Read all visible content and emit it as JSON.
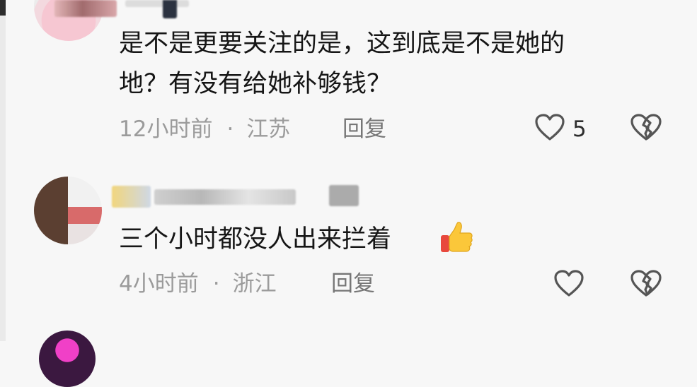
{
  "comments": [
    {
      "text_line1": "是不是更要关注的是，这到底是不是她的",
      "text_line2": "地？有没有给她补够钱？",
      "time": "12小时前",
      "separator": "·",
      "location": "江苏",
      "reply_label": "回复",
      "like_count": "5",
      "like_icon": "heart-icon",
      "dislike_icon": "broken-heart-icon"
    },
    {
      "text_line1": "三个小时都没人出来拦着",
      "emoji": "thumbs-up-icon",
      "time": "4小时前",
      "separator": "·",
      "location": "浙江",
      "reply_label": "回复",
      "like_count": "",
      "like_icon": "heart-icon",
      "dislike_icon": "broken-heart-icon"
    }
  ],
  "colors": {
    "background": "#f7f7f7",
    "text": "#161616",
    "meta": "#9b9b9b",
    "icon": "#555555",
    "like_count": "#2e2e2e"
  }
}
